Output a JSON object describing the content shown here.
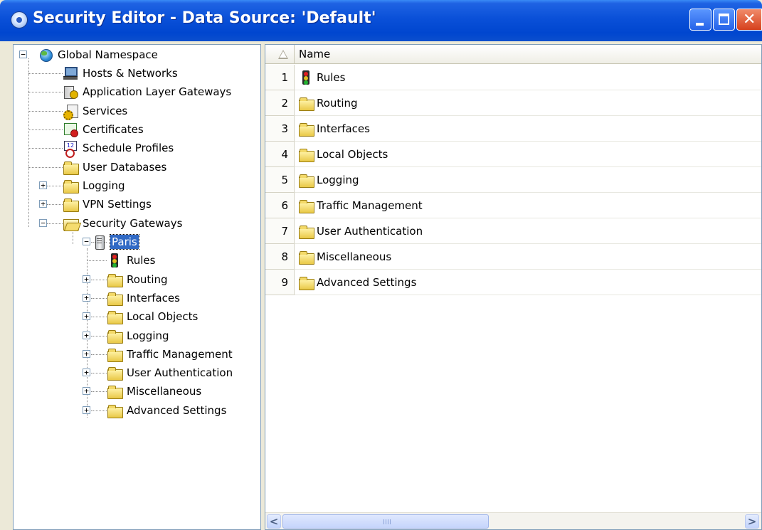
{
  "window": {
    "title": "Security Editor - Data Source: 'Default'",
    "colors": {
      "titlebar": "#0a50d8",
      "selection": "#316ac5",
      "folder": "#e9c846"
    }
  },
  "tree": {
    "root": {
      "label": "Global Namespace",
      "icon": "globe-icon",
      "expanded": true
    },
    "level1": [
      {
        "label": "Hosts & Networks",
        "icon": "network-icon"
      },
      {
        "label": "Application Layer Gateways",
        "icon": "gateway-icon"
      },
      {
        "label": "Services",
        "icon": "services-icon"
      },
      {
        "label": "Certificates",
        "icon": "certificate-icon"
      },
      {
        "label": "Schedule Profiles",
        "icon": "schedule-icon"
      },
      {
        "label": "User Databases",
        "icon": "folder-icon"
      },
      {
        "label": "Logging",
        "icon": "folder-icon",
        "expandable": true
      },
      {
        "label": "VPN Settings",
        "icon": "folder-icon",
        "expandable": true
      },
      {
        "label": "Security Gateways",
        "icon": "folder-open-icon",
        "expanded": true
      }
    ],
    "gateway": {
      "label": "Paris",
      "icon": "server-icon",
      "selected": true,
      "expanded": true
    },
    "gateway_children": [
      {
        "label": "Rules",
        "icon": "traffic-light-icon"
      },
      {
        "label": "Routing",
        "icon": "folder-icon",
        "expandable": true
      },
      {
        "label": "Interfaces",
        "icon": "folder-icon",
        "expandable": true
      },
      {
        "label": "Local Objects",
        "icon": "folder-icon",
        "expandable": true
      },
      {
        "label": "Logging",
        "icon": "folder-icon",
        "expandable": true
      },
      {
        "label": "Traffic Management",
        "icon": "folder-icon",
        "expandable": true
      },
      {
        "label": "User Authentication",
        "icon": "folder-icon",
        "expandable": true
      },
      {
        "label": "Miscellaneous",
        "icon": "folder-icon",
        "expandable": true
      },
      {
        "label": "Advanced Settings",
        "icon": "folder-icon",
        "expandable": true
      }
    ]
  },
  "grid": {
    "column_header": "Name",
    "rows": [
      {
        "num": "1",
        "name": "Rules",
        "icon": "traffic-light-icon"
      },
      {
        "num": "2",
        "name": "Routing",
        "icon": "folder-icon"
      },
      {
        "num": "3",
        "name": "Interfaces",
        "icon": "folder-icon"
      },
      {
        "num": "4",
        "name": "Local Objects",
        "icon": "folder-icon"
      },
      {
        "num": "5",
        "name": "Logging",
        "icon": "folder-icon"
      },
      {
        "num": "6",
        "name": "Traffic Management",
        "icon": "folder-icon"
      },
      {
        "num": "7",
        "name": "User Authentication",
        "icon": "folder-icon"
      },
      {
        "num": "8",
        "name": "Miscellaneous",
        "icon": "folder-icon"
      },
      {
        "num": "9",
        "name": "Advanced Settings",
        "icon": "folder-icon"
      }
    ],
    "scrollbar": {
      "left_glyph": "<",
      "right_glyph": ">",
      "grip_glyph": "III"
    }
  }
}
